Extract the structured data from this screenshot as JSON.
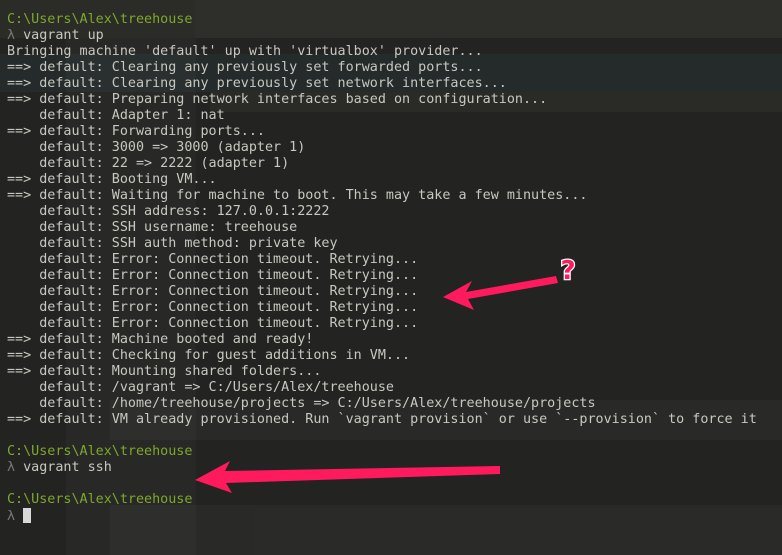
{
  "terminal": {
    "lines": [
      {
        "type": "path",
        "text": "C:\\Users\\Alex\\treehouse"
      },
      {
        "type": "cmd",
        "text": "vagrant up"
      },
      {
        "type": "out",
        "text": "Bringing machine 'default' up with 'virtualbox' provider..."
      },
      {
        "type": "out",
        "text": "==> default: Clearing any previously set forwarded ports..."
      },
      {
        "type": "out",
        "text": "==> default: Clearing any previously set network interfaces..."
      },
      {
        "type": "out",
        "text": "==> default: Preparing network interfaces based on configuration..."
      },
      {
        "type": "out",
        "text": "    default: Adapter 1: nat"
      },
      {
        "type": "out",
        "text": "==> default: Forwarding ports..."
      },
      {
        "type": "out",
        "text": "    default: 3000 => 3000 (adapter 1)"
      },
      {
        "type": "out",
        "text": "    default: 22 => 2222 (adapter 1)"
      },
      {
        "type": "out",
        "text": "==> default: Booting VM..."
      },
      {
        "type": "out",
        "text": "==> default: Waiting for machine to boot. This may take a few minutes..."
      },
      {
        "type": "out",
        "text": "    default: SSH address: 127.0.0.1:2222"
      },
      {
        "type": "out",
        "text": "    default: SSH username: treehouse"
      },
      {
        "type": "out",
        "text": "    default: SSH auth method: private key"
      },
      {
        "type": "out",
        "text": "    default: Error: Connection timeout. Retrying..."
      },
      {
        "type": "out",
        "text": "    default: Error: Connection timeout. Retrying..."
      },
      {
        "type": "out",
        "text": "    default: Error: Connection timeout. Retrying..."
      },
      {
        "type": "out",
        "text": "    default: Error: Connection timeout. Retrying..."
      },
      {
        "type": "out",
        "text": "    default: Error: Connection timeout. Retrying..."
      },
      {
        "type": "out",
        "text": "==> default: Machine booted and ready!"
      },
      {
        "type": "out",
        "text": "==> default: Checking for guest additions in VM..."
      },
      {
        "type": "out",
        "text": "==> default: Mounting shared folders..."
      },
      {
        "type": "out",
        "text": "    default: /vagrant => C:/Users/Alex/treehouse"
      },
      {
        "type": "out",
        "text": "    default: /home/treehouse/projects => C:/Users/Alex/treehouse/projects"
      },
      {
        "type": "out",
        "text": "==> default: VM already provisioned. Run `vagrant provision` or use `--provision` to force it"
      },
      {
        "type": "blank",
        "text": ""
      },
      {
        "type": "path",
        "text": "C:\\Users\\Alex\\treehouse"
      },
      {
        "type": "cmd",
        "text": "vagrant ssh"
      },
      {
        "type": "blank",
        "text": ""
      },
      {
        "type": "path",
        "text": "C:\\Users\\Alex\\treehouse"
      },
      {
        "type": "input",
        "text": ""
      }
    ],
    "prompt_symbol": "λ"
  },
  "annotations": {
    "question_mark": "?",
    "arrow_color": "#ff1a5e"
  }
}
